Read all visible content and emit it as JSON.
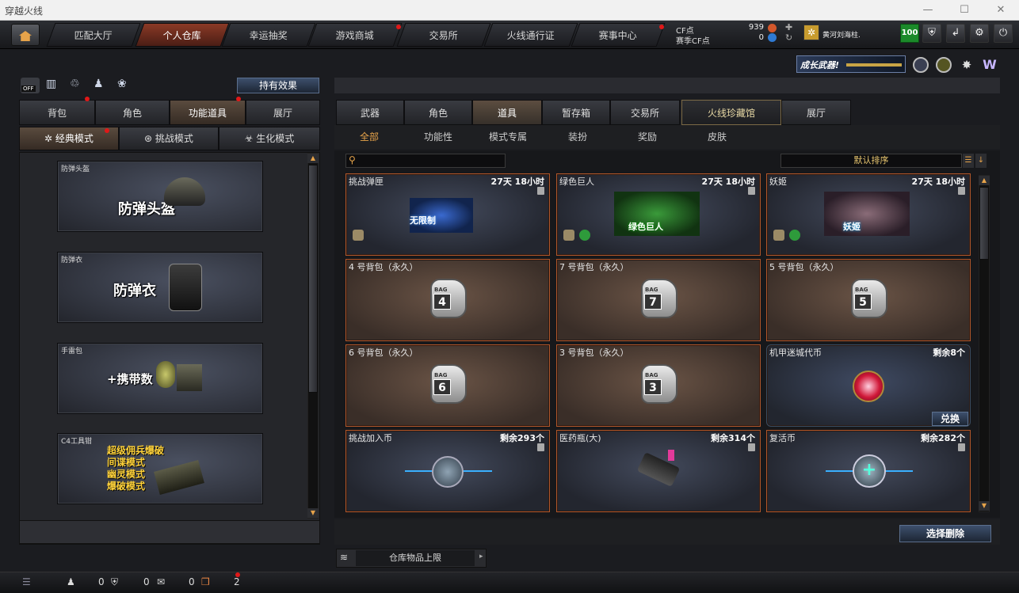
{
  "window": {
    "title": "穿越火线"
  },
  "nav": {
    "tabs": [
      "匹配大厅",
      "个人仓库",
      "幸运抽奖",
      "游戏商城",
      "交易所",
      "火线通行证",
      "赛事中心"
    ],
    "cf_label": "CF点",
    "cf_value": "939",
    "event_label": "赛季CF点",
    "event_value": "0",
    "username": "黄河刘海柱.",
    "level": "100"
  },
  "banner": {
    "text": "成长武器!"
  },
  "left": {
    "effect_button": "持有效果",
    "off_label": "OFF",
    "tabs": [
      "背包",
      "角色",
      "功能道具",
      "展厅"
    ],
    "modes": [
      "经典模式",
      "挑战模式",
      "生化模式"
    ],
    "cards": [
      {
        "caption": "防弹头盔",
        "big": "防弹头盔"
      },
      {
        "caption": "防弹衣",
        "big": "防弹衣"
      },
      {
        "caption": "手雷包",
        "big": "+携带数"
      },
      {
        "caption": "C4工具钳",
        "lines": [
          "超级佣兵爆破",
          "间谍模式",
          "幽灵模式",
          "爆破模式"
        ]
      }
    ]
  },
  "right": {
    "tabs": [
      "武器",
      "角色",
      "道具",
      "暂存箱",
      "交易所",
      "火线珍藏馆",
      "展厅"
    ],
    "subtabs": [
      "全部",
      "功能性",
      "模式专属",
      "装扮",
      "奖励",
      "皮肤"
    ],
    "search": {
      "placeholder": ""
    },
    "sort_label": "默认排序",
    "items": [
      {
        "name": "挑战弹匣",
        "right": "27天 18小时",
        "art": "无限制",
        "style": "blue"
      },
      {
        "name": "绿色巨人",
        "right": "27天 18小时",
        "art": "绿色巨人",
        "style": "blue"
      },
      {
        "name": "妖姬",
        "right": "27天 18小时",
        "art": "妖姬",
        "style": "blue"
      },
      {
        "name": "4 号背包（永久）",
        "right": "",
        "bag": "4",
        "style": "brown"
      },
      {
        "name": "7 号背包（永久）",
        "right": "",
        "bag": "7",
        "style": "brown"
      },
      {
        "name": "5 号背包（永久）",
        "right": "",
        "bag": "5",
        "style": "brown"
      },
      {
        "name": "6 号背包（永久）",
        "right": "",
        "bag": "6",
        "style": "brown"
      },
      {
        "name": "3 号背包（永久）",
        "right": "",
        "bag": "3",
        "style": "brown"
      },
      {
        "name": "机甲迷城代币",
        "right": "剩余8个",
        "style": "coin",
        "button": "兑换"
      },
      {
        "name": "挑战加入币",
        "right": "剩余293个",
        "style": "blue"
      },
      {
        "name": "医药瓶(大)",
        "right": "剩余314个",
        "style": "blue"
      },
      {
        "name": "复活币",
        "right": "剩余282个",
        "style": "blue"
      }
    ],
    "bag_label": "BAG",
    "delete_button": "选择删除",
    "capacity_label": "仓库物品上限"
  },
  "status": {
    "counts": [
      "0",
      "0",
      "0",
      "2"
    ]
  },
  "colors": {
    "accent": "#e6a34a",
    "border_orange": "#b0562a",
    "active_tab": "#8a3a26"
  }
}
